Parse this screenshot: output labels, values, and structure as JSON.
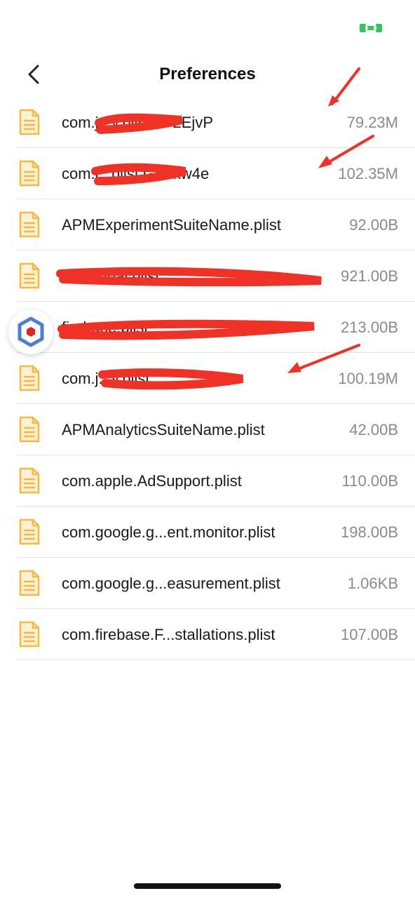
{
  "header": {
    "title": "Preferences"
  },
  "files": [
    {
      "name": "com.j...y.plist.aP2EjvP",
      "size": "79.23M"
    },
    {
      "name": "com.j...plist.GhTkw4e",
      "size": "102.35M"
    },
    {
      "name": "APMExperimentSuiteName.plist",
      "size": "92.00B"
    },
    {
      "name": "onesignal.plist",
      "size": "921.00B"
    },
    {
      "name": "firebase.plist",
      "size": "213.00B"
    },
    {
      "name": "com.j...y.plist",
      "size": "100.19M"
    },
    {
      "name": "APMAnalyticsSuiteName.plist",
      "size": "42.00B"
    },
    {
      "name": "com.apple.AdSupport.plist",
      "size": "110.00B"
    },
    {
      "name": "com.google.g...ent.monitor.plist",
      "size": "198.00B"
    },
    {
      "name": "com.google.g...easurement.plist",
      "size": "1.06KB"
    },
    {
      "name": "com.firebase.F...stallations.plist",
      "size": "107.00B"
    }
  ],
  "colors": {
    "file_icon": "#f5b942",
    "status_indicator": "#34c759",
    "annotation": "#f03226",
    "floating_button_accent": "#4a7fd6",
    "floating_button_center": "#e02424"
  },
  "icons": {
    "back": "chevron-left-icon",
    "file": "document-icon",
    "floating": "hexagon-icon"
  }
}
